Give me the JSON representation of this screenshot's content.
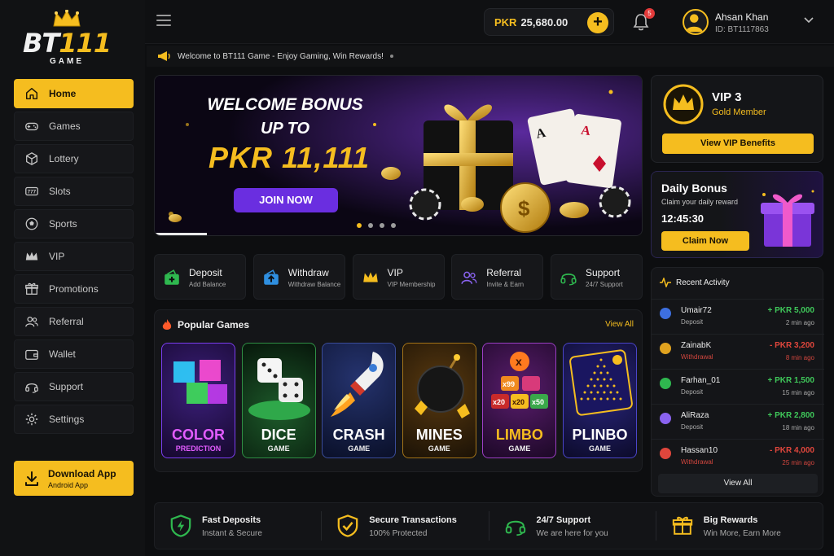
{
  "brand": {
    "name_main": "BT",
    "name_accent": "111",
    "sub": "GAME"
  },
  "sidebar": {
    "items": [
      {
        "label": "Home",
        "icon": "home-icon",
        "active": true
      },
      {
        "label": "Games",
        "icon": "gamepad-icon"
      },
      {
        "label": "Lottery",
        "icon": "cube-icon"
      },
      {
        "label": "Slots",
        "icon": "slots-icon"
      },
      {
        "label": "Sports",
        "icon": "ball-icon"
      },
      {
        "label": "VIP",
        "icon": "crown-icon"
      },
      {
        "label": "Promotions",
        "icon": "gift-icon"
      },
      {
        "label": "Referral",
        "icon": "users-icon"
      },
      {
        "label": "Wallet",
        "icon": "wallet-icon"
      },
      {
        "label": "Support",
        "icon": "headset-icon"
      },
      {
        "label": "Settings",
        "icon": "gear-icon"
      }
    ],
    "download": {
      "title": "Download App",
      "sub": "Android App"
    }
  },
  "header": {
    "currency": "PKR",
    "balance": "25,680.00",
    "add": "+",
    "notifications": "5",
    "user_name": "Ahsan Khan",
    "user_id": "ID: BT1117863"
  },
  "ticker": {
    "text": "Welcome to BT111 Game - Enjoy Gaming, Win Rewards!"
  },
  "banner": {
    "line1": "WELCOME BONUS",
    "line2": "UP TO",
    "line3": "PKR 11,111",
    "cta": "JOIN NOW",
    "slides": 4,
    "active_slide": 1
  },
  "quick_actions": [
    {
      "title": "Deposit",
      "sub": "Add Balance",
      "icon": "wallet-plus-icon",
      "color": "#2fb84f"
    },
    {
      "title": "Withdraw",
      "sub": "Withdraw Balance",
      "icon": "wallet-arrow-icon",
      "color": "#2f8fe0"
    },
    {
      "title": "VIP",
      "sub": "VIP Membership",
      "icon": "crown-icon",
      "color": "#f5bd1f"
    },
    {
      "title": "Referral",
      "sub": "Invite & Earn",
      "icon": "users-icon",
      "color": "#8a63f0"
    },
    {
      "title": "Support",
      "sub": "24/7 Support",
      "icon": "headset-icon",
      "color": "#2fb84f"
    }
  ],
  "popular": {
    "title": "Popular Games",
    "view_all": "View All",
    "games": [
      {
        "name": "COLOR",
        "sub": "PREDICTION"
      },
      {
        "name": "DICE",
        "sub": "GAME"
      },
      {
        "name": "CRASH",
        "sub": "GAME"
      },
      {
        "name": "MINES",
        "sub": "GAME"
      },
      {
        "name": "LIMBO",
        "sub": "GAME"
      },
      {
        "name": "PLINBO",
        "sub": "GAME"
      }
    ]
  },
  "vip_card": {
    "level": "VIP 3",
    "tier": "Gold Member",
    "cta": "View VIP Benefits"
  },
  "daily_bonus": {
    "title": "Daily Bonus",
    "sub": "Claim your daily reward",
    "timer": "12:45:30",
    "cta": "Claim Now"
  },
  "activity": {
    "title": "Recent Activity",
    "rows": [
      {
        "name": "Umair72",
        "type": "Deposit",
        "amount": "+ PKR 5,000",
        "ago": "2 min ago",
        "kind": "pos",
        "color": "#3d6fe0"
      },
      {
        "name": "ZainabK",
        "type": "Withdrawal",
        "amount": "- PKR 3,200",
        "ago": "8 min ago",
        "kind": "neg",
        "color": "#e0a21f"
      },
      {
        "name": "Farhan_01",
        "type": "Deposit",
        "amount": "+ PKR 1,500",
        "ago": "15 min ago",
        "kind": "pos",
        "color": "#2fb84f"
      },
      {
        "name": "AliRaza",
        "type": "Deposit",
        "amount": "+ PKR 2,800",
        "ago": "18 min ago",
        "kind": "pos",
        "color": "#8a63f0"
      },
      {
        "name": "Hassan10",
        "type": "Withdrawal",
        "amount": "- PKR 4,000",
        "ago": "25 min ago",
        "kind": "neg",
        "color": "#e0463c"
      }
    ],
    "view_all": "View All"
  },
  "features": [
    {
      "title": "Fast Deposits",
      "sub": "Instant & Secure",
      "icon": "bolt-shield-icon",
      "color": "#2fb84f"
    },
    {
      "title": "Secure Transactions",
      "sub": "100% Protected",
      "icon": "shield-check-icon",
      "color": "#f5bd1f"
    },
    {
      "title": "24/7 Support",
      "sub": "We are here for you",
      "icon": "headset-icon",
      "color": "#2fb84f"
    },
    {
      "title": "Big Rewards",
      "sub": "Win More, Earn More",
      "icon": "gift-icon",
      "color": "#f5bd1f"
    }
  ]
}
